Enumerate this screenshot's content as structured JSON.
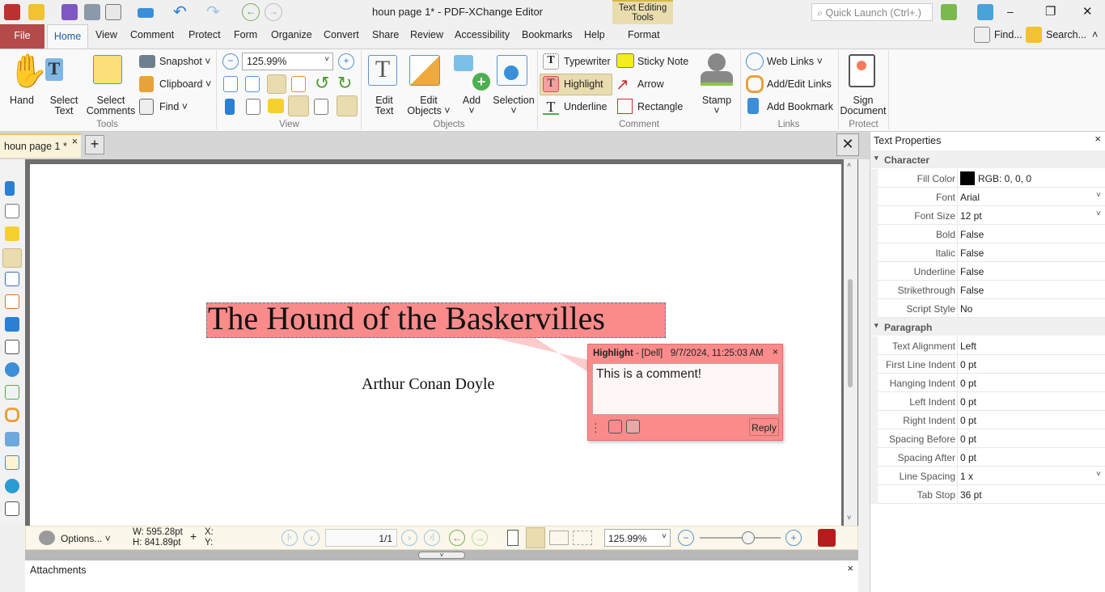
{
  "window": {
    "title": "houn page 1* - PDF-XChange Editor",
    "quick_launch_placeholder": "Quick Launch (Ctrl+.)",
    "minimize": "–",
    "maximize": "❐",
    "close": "✕"
  },
  "menu_tabs": [
    "File",
    "Home",
    "View",
    "Comment",
    "Protect",
    "Form",
    "Organize",
    "Convert",
    "Share",
    "Review",
    "Accessibility",
    "Bookmarks",
    "Help"
  ],
  "context_tab": {
    "group": "Text Editing Tools",
    "label": "Format"
  },
  "top_right": {
    "find": "Find...",
    "search": "Search..."
  },
  "ribbon": {
    "tools": {
      "hand": "Hand",
      "select_text": [
        "Select",
        "Text"
      ],
      "select_comments": [
        "Select",
        "Comments"
      ],
      "snapshot": "Snapshot",
      "clipboard": "Clipboard",
      "find": "Find",
      "group": "Tools"
    },
    "view": {
      "zoom": "125.99%",
      "group": "View"
    },
    "objects": {
      "edit_text": [
        "Edit",
        "Text"
      ],
      "edit_objects": [
        "Edit",
        "Objects"
      ],
      "add": "Add",
      "selection": "Selection",
      "group": "Objects"
    },
    "comment": {
      "typewriter": "Typewriter",
      "sticky_note": "Sticky Note",
      "highlight": "Highlight",
      "arrow": "Arrow",
      "underline": "Underline",
      "rectangle": "Rectangle",
      "stamp": "Stamp",
      "group": "Comment"
    },
    "links": {
      "web_links": "Web Links",
      "add_edit_links": "Add/Edit Links",
      "add_bookmark": "Add Bookmark",
      "group": "Links"
    },
    "protect": {
      "sign_document": [
        "Sign",
        "Document"
      ],
      "group": "Protect"
    }
  },
  "doc_tab": {
    "label": "houn page 1 *",
    "close": "×",
    "new": "+"
  },
  "document": {
    "title": "The Hound of the Baskervilles",
    "author": "Arthur Conan Doyle"
  },
  "comment_popup": {
    "type": "Highlight",
    "author": "- [Dell]",
    "datetime": "9/7/2024, 11:25:03 AM",
    "text": "This is a comment!",
    "reply": "Reply",
    "close": "×",
    "color": "#f98b8b"
  },
  "status_bar": {
    "options": "Options...",
    "width": "W: 595.28pt",
    "height": "H: 841.89pt",
    "x": "X:",
    "y": "Y:",
    "page": "1/1",
    "zoom": "125.99%",
    "zoom_slider_percent": 50
  },
  "attachments": {
    "title": "Attachments",
    "close": "×"
  },
  "properties": {
    "title": "Text Properties",
    "close": "×",
    "sections": [
      {
        "name": "Character",
        "rows": [
          {
            "key": "Fill Color",
            "value": "RGB: 0, 0, 0",
            "swatch": "#000000"
          },
          {
            "key": "Font",
            "value": "Arial",
            "dropdown": true
          },
          {
            "key": "Font Size",
            "value": "12 pt",
            "dropdown": true
          },
          {
            "key": "Bold",
            "value": "False"
          },
          {
            "key": "Italic",
            "value": "False"
          },
          {
            "key": "Underline",
            "value": "False"
          },
          {
            "key": "Strikethrough",
            "value": "False"
          },
          {
            "key": "Script Style",
            "value": "No"
          }
        ]
      },
      {
        "name": "Paragraph",
        "rows": [
          {
            "key": "Text Alignment",
            "value": "Left"
          },
          {
            "key": "First Line Indent",
            "value": "0 pt"
          },
          {
            "key": "Hanging Indent",
            "value": "0 pt"
          },
          {
            "key": "Left Indent",
            "value": "0 pt"
          },
          {
            "key": "Right Indent",
            "value": "0 pt"
          },
          {
            "key": "Spacing Before",
            "value": "0 pt"
          },
          {
            "key": "Spacing After",
            "value": "0 pt"
          },
          {
            "key": "Line Spacing",
            "value": "1 x",
            "dropdown": true
          },
          {
            "key": "Tab Stop",
            "value": "36 pt"
          }
        ]
      }
    ]
  }
}
